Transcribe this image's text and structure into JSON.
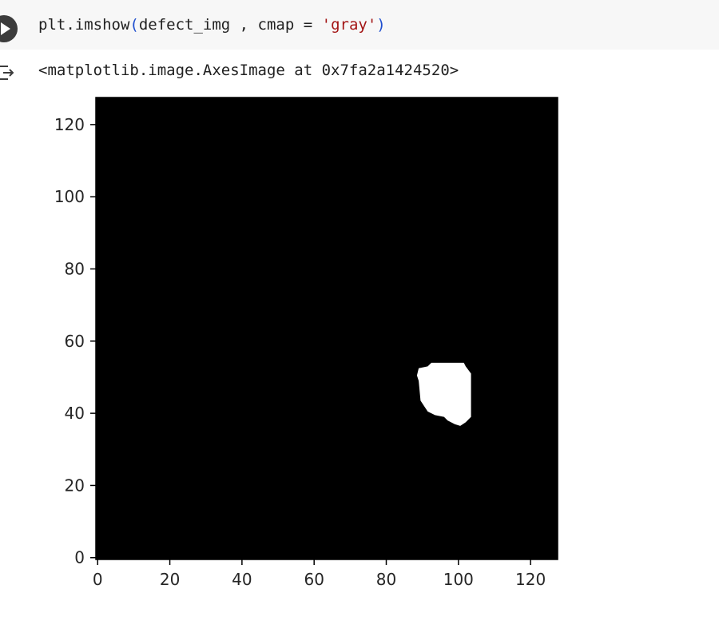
{
  "code_cell": {
    "code_prefix": "plt.imshow",
    "open_paren": "(",
    "code_args": "defect_img , cmap = ",
    "string_arg": "'gray'",
    "close_paren": ")",
    "run_icon": "play-icon"
  },
  "output": {
    "icon": "output-arrow-icon",
    "repr_text": "<matplotlib.image.AxesImage at 0x7fa2a1424520>"
  },
  "chart_data": {
    "type": "heatmap",
    "colormap": "gray",
    "image_shape": [
      128,
      128
    ],
    "xlim": [
      -0.5,
      127.5
    ],
    "ylim": [
      127.5,
      -0.5
    ],
    "x_ticks": [
      "0",
      "20",
      "40",
      "60",
      "80",
      "100",
      "120"
    ],
    "y_ticks": [
      "0",
      "20",
      "40",
      "60",
      "80",
      "100",
      "120"
    ],
    "background_value": 0,
    "blob_value": 255,
    "blob_boundary_xy": [
      [
        89.5,
        43.5
      ],
      [
        90.5,
        42
      ],
      [
        91.5,
        40.5
      ],
      [
        93.5,
        39.5
      ],
      [
        96,
        39
      ],
      [
        97,
        38
      ],
      [
        99,
        37
      ],
      [
        100.5,
        36.5
      ],
      [
        102,
        37.5
      ],
      [
        103.5,
        39
      ],
      [
        103.5,
        51
      ],
      [
        102,
        53
      ],
      [
        101.5,
        54
      ],
      [
        92.5,
        54
      ],
      [
        91.5,
        53
      ],
      [
        89,
        52.5
      ],
      [
        88.5,
        50.5
      ],
      [
        89,
        49
      ]
    ]
  }
}
